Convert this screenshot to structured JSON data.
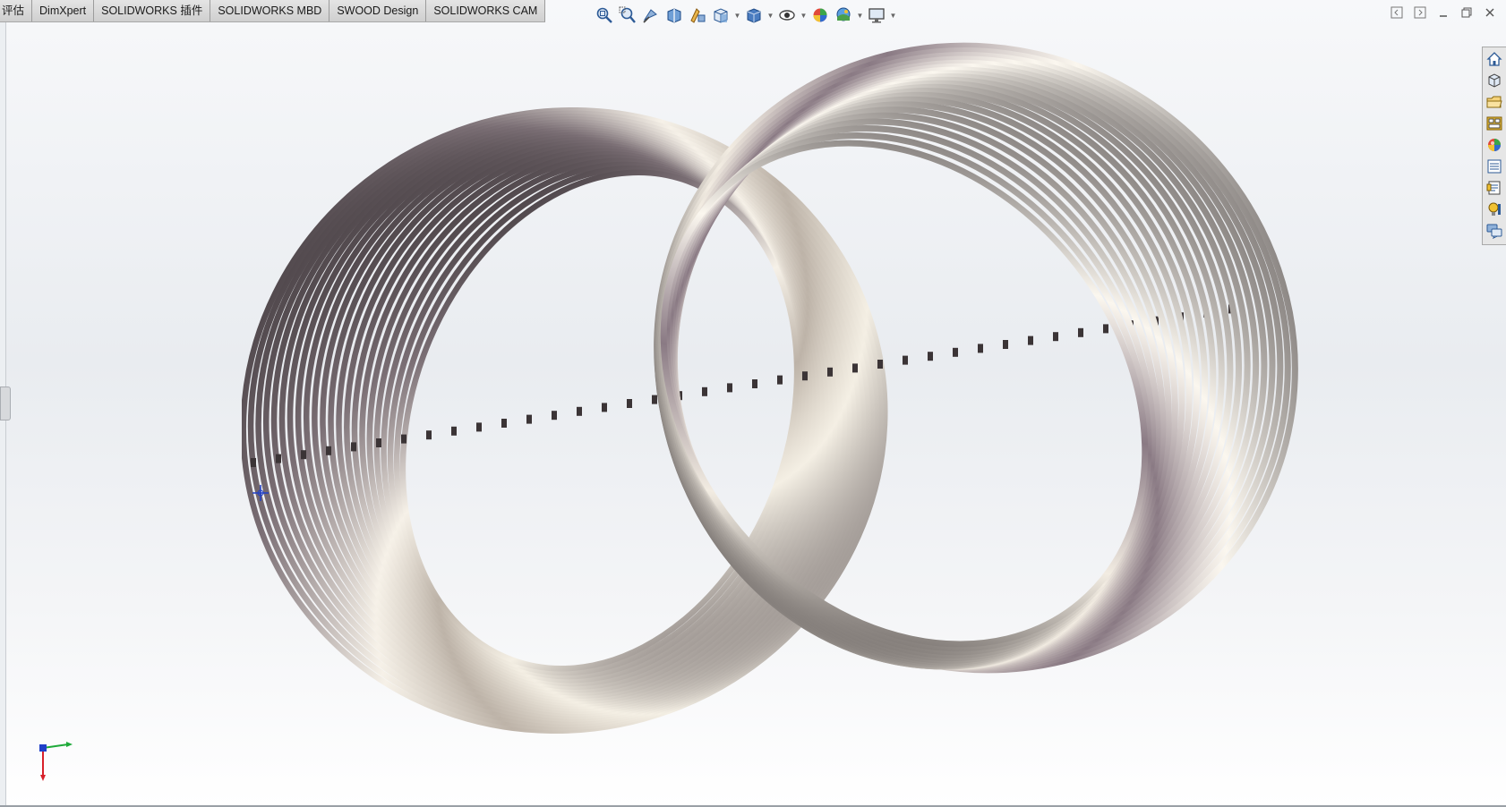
{
  "tabs": [
    {
      "label": "评估"
    },
    {
      "label": "DimXpert"
    },
    {
      "label": "SOLIDWORKS 插件"
    },
    {
      "label": "SOLIDWORKS MBD"
    },
    {
      "label": "SWOOD Design"
    },
    {
      "label": "SOLIDWORKS CAM"
    }
  ],
  "heads_up_toolbar": [
    {
      "icon": "zoom-to-fit-icon"
    },
    {
      "icon": "zoom-to-area-icon"
    },
    {
      "icon": "previous-view-icon"
    },
    {
      "icon": "section-view-icon"
    },
    {
      "icon": "dynamic-annotation-views-icon"
    },
    {
      "icon": "view-orientation-icon",
      "dropdown": true
    },
    {
      "icon": "display-style-icon",
      "dropdown": true
    },
    {
      "icon": "hide-show-items-icon",
      "dropdown": true
    },
    {
      "icon": "edit-appearance-icon"
    },
    {
      "icon": "apply-scene-icon",
      "dropdown": true
    },
    {
      "icon": "view-settings-icon",
      "dropdown": true
    }
  ],
  "window_controls": [
    {
      "icon": "tile-left-icon"
    },
    {
      "icon": "tile-right-icon"
    },
    {
      "icon": "minimize-icon"
    },
    {
      "icon": "restore-icon"
    },
    {
      "icon": "close-icon"
    }
  ],
  "task_pane": [
    {
      "icon": "solidworks-resources-icon"
    },
    {
      "icon": "design-library-icon"
    },
    {
      "icon": "file-explorer-icon"
    },
    {
      "icon": "view-palette-icon"
    },
    {
      "icon": "appearances-scenes-icon"
    },
    {
      "icon": "custom-properties-icon"
    },
    {
      "icon": "solidworks-forum-icon"
    },
    {
      "icon": "tips-icon"
    },
    {
      "icon": "feedback-icon"
    }
  ],
  "colors": {
    "viewport_top": "#f7f8fa",
    "viewport_mid": "#e9ecf0",
    "model_light": "#f2ece2",
    "model_dark": "#2a2426",
    "model_shadow": "#8a7a84",
    "triad_x": "#d8202a",
    "triad_y": "#1faa3a",
    "triad_z": "#2040c8"
  }
}
